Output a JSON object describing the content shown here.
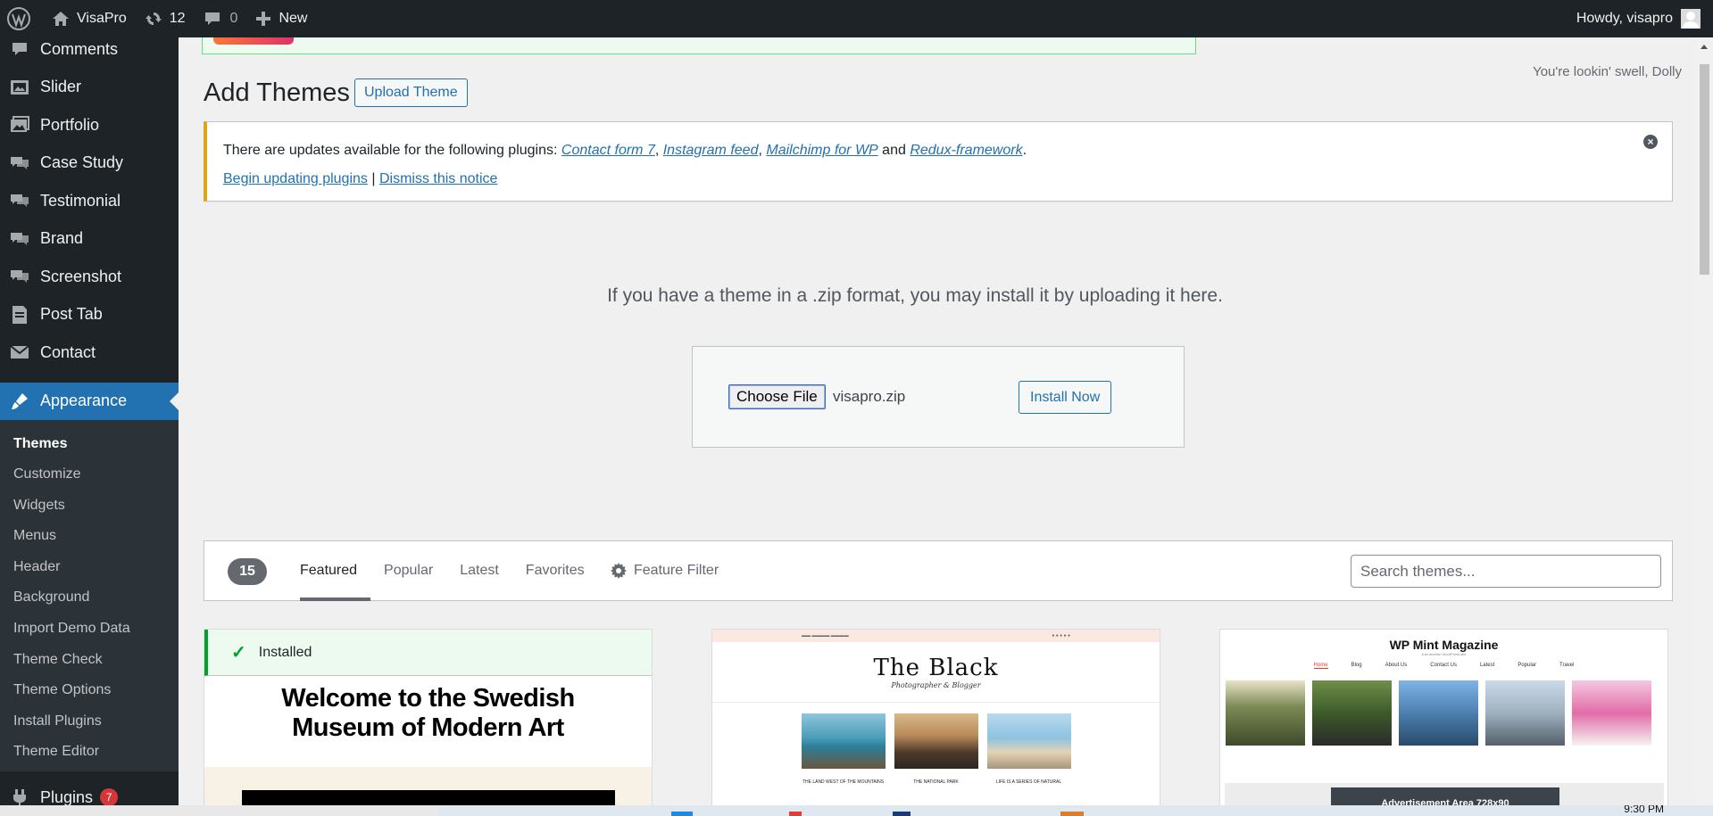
{
  "admin_bar": {
    "site_name": "VisaPro",
    "updates_count": "12",
    "comments_count": "0",
    "new_label": "New",
    "howdy": "Howdy, visapro"
  },
  "sidebar": {
    "items": [
      {
        "label": "Comments",
        "icon": "comment-icon"
      },
      {
        "label": "Slider",
        "icon": "slider-icon"
      },
      {
        "label": "Portfolio",
        "icon": "portfolio-icon"
      },
      {
        "label": "Case Study",
        "icon": "case-study-icon"
      },
      {
        "label": "Testimonial",
        "icon": "testimonial-icon"
      },
      {
        "label": "Brand",
        "icon": "brand-icon"
      },
      {
        "label": "Screenshot",
        "icon": "screenshot-icon"
      },
      {
        "label": "Post Tab",
        "icon": "post-tab-icon"
      },
      {
        "label": "Contact",
        "icon": "contact-icon"
      }
    ],
    "current": {
      "label": "Appearance",
      "icon": "paintbrush-icon"
    },
    "submenu": [
      {
        "label": "Themes",
        "current": true
      },
      {
        "label": "Customize"
      },
      {
        "label": "Widgets"
      },
      {
        "label": "Menus"
      },
      {
        "label": "Header"
      },
      {
        "label": "Background"
      },
      {
        "label": "Import Demo Data"
      },
      {
        "label": "Theme Check"
      },
      {
        "label": "Theme Options"
      },
      {
        "label": "Install Plugins"
      },
      {
        "label": "Theme Editor"
      }
    ],
    "plugins": {
      "label": "Plugins",
      "badge": "7"
    }
  },
  "dolly": "You're lookin' swell, Dolly",
  "page": {
    "title": "Add Themes",
    "upload_theme": "Upload Theme"
  },
  "notice": {
    "intro": "There are updates available for the following plugins: ",
    "plugins": [
      "Contact form 7",
      "Instagram feed",
      "Mailchimp for WP",
      "Redux-framework"
    ],
    "and": " and ",
    "begin_updating": "Begin updating plugins",
    "separator": " | ",
    "dismiss": "Dismiss this notice"
  },
  "upload": {
    "help_text": "If you have a theme in a .zip format, you may install it by uploading it here.",
    "choose_file": "Choose File",
    "file_name": "visapro.zip",
    "install_now": "Install Now"
  },
  "filter": {
    "count": "15",
    "tabs": [
      "Featured",
      "Popular",
      "Latest",
      "Favorites"
    ],
    "current_tab": "Featured",
    "feature_filter": "Feature Filter",
    "search_placeholder": "Search themes..."
  },
  "themes": [
    {
      "installed_label": "Installed",
      "screenshot_title": "Welcome to the Swedish Museum of Modern Art"
    },
    {
      "screenshot_title": "The Black",
      "screenshot_tagline": "Photographer & Blogger",
      "posts": [
        "THE LAND WEST OF THE MOUNTAINS",
        "THE NATIONAL PARK",
        "LIFE IS A SERIES OF NATURAL"
      ]
    },
    {
      "screenshot_title": "WP Mint Magazine",
      "screenshot_subtitle": "Just another WordPress site",
      "nav": [
        "Home",
        "Blog",
        "About Us",
        "Contact Us",
        "Latest",
        "Popular",
        "Travel"
      ],
      "ad_text": "Advertisement Area 728x90"
    }
  ],
  "taskbar": {
    "time": "9:30 PM"
  },
  "colors": {
    "admin_bar_bg": "#1d2327",
    "accent": "#2271b1",
    "notice_warning": "#dba617",
    "installed_green": "#00a32a"
  }
}
